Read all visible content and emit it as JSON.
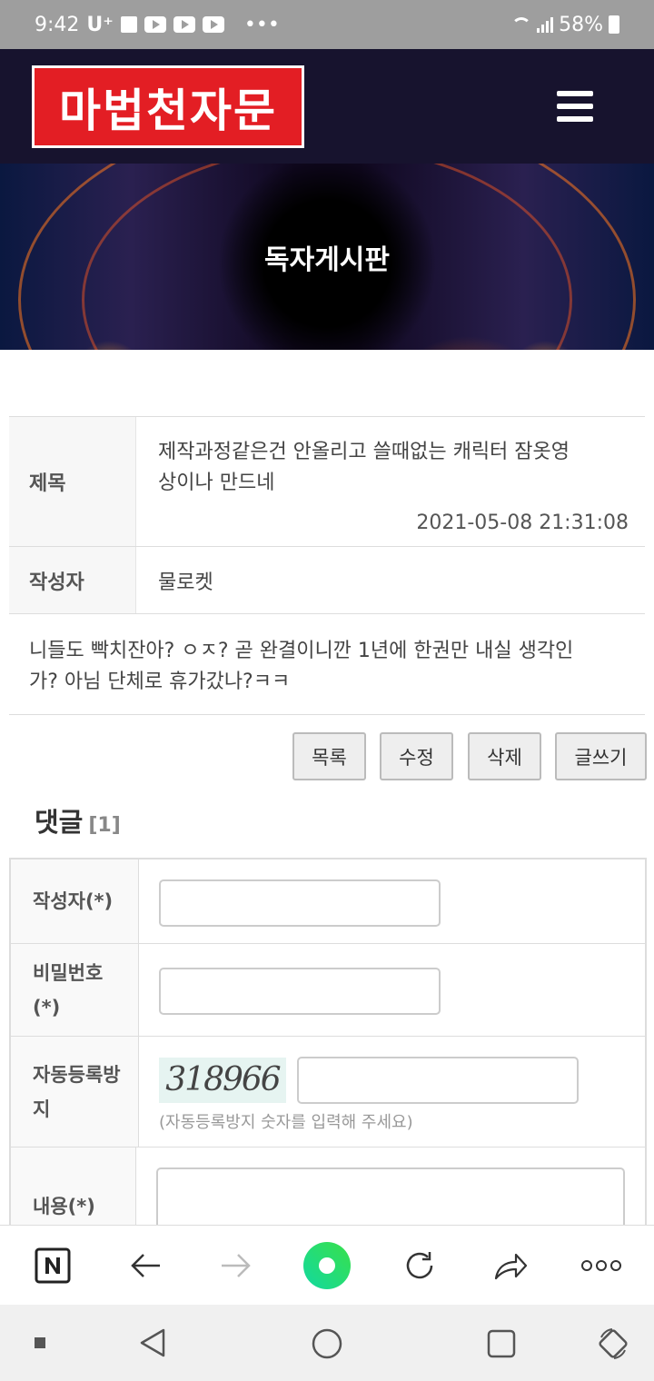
{
  "status": {
    "time": "9:42",
    "carrier": "U⁺",
    "battery": "58%"
  },
  "header": {
    "logo": "마법천자문"
  },
  "banner": {
    "title": "독자게시판"
  },
  "post": {
    "title_label": "제목",
    "title_line1": "제작과정같은건 안올리고 쓸때없는 캐릭터 잠옷영",
    "title_line2": "상이나 만드네",
    "date": "2021-05-08 21:31:08",
    "author_label": "작성자",
    "author": "물로켓",
    "content_line1": "니들도 빡치잔아? ㅇㅈ? 곧 완결이니깐 1년에 한권만 내실 생각인",
    "content_line2": "가? 아님 단체로 휴가갔나?ㅋㅋ"
  },
  "buttons": {
    "list": "목록",
    "edit": "수정",
    "delete": "삭제",
    "write": "글쓰기"
  },
  "comments": {
    "heading": "댓글",
    "count": "[1]",
    "author_label": "작성자(*)",
    "password_label_1": "비밀번호",
    "password_label_2": "(*)",
    "captcha_label_1": "자동등록방",
    "captcha_label_2": "지",
    "captcha_code": "318966",
    "captcha_hint": "(자동등록방지 숫자를 입력해 주세요)",
    "content_label": "내용(*)"
  },
  "icons": {
    "browser": [
      "naver-icon",
      "back-arrow-icon",
      "forward-arrow-icon",
      "green-dot-icon",
      "refresh-icon",
      "share-icon",
      "more-icon"
    ],
    "system": [
      "square-dot-icon",
      "back-triangle-icon",
      "home-circle-icon",
      "recents-square-icon",
      "rotate-icon"
    ]
  },
  "colors": {
    "header_bg": "#17132e",
    "logo_red": "#e31e24",
    "accent_green": "#2ecc71"
  }
}
